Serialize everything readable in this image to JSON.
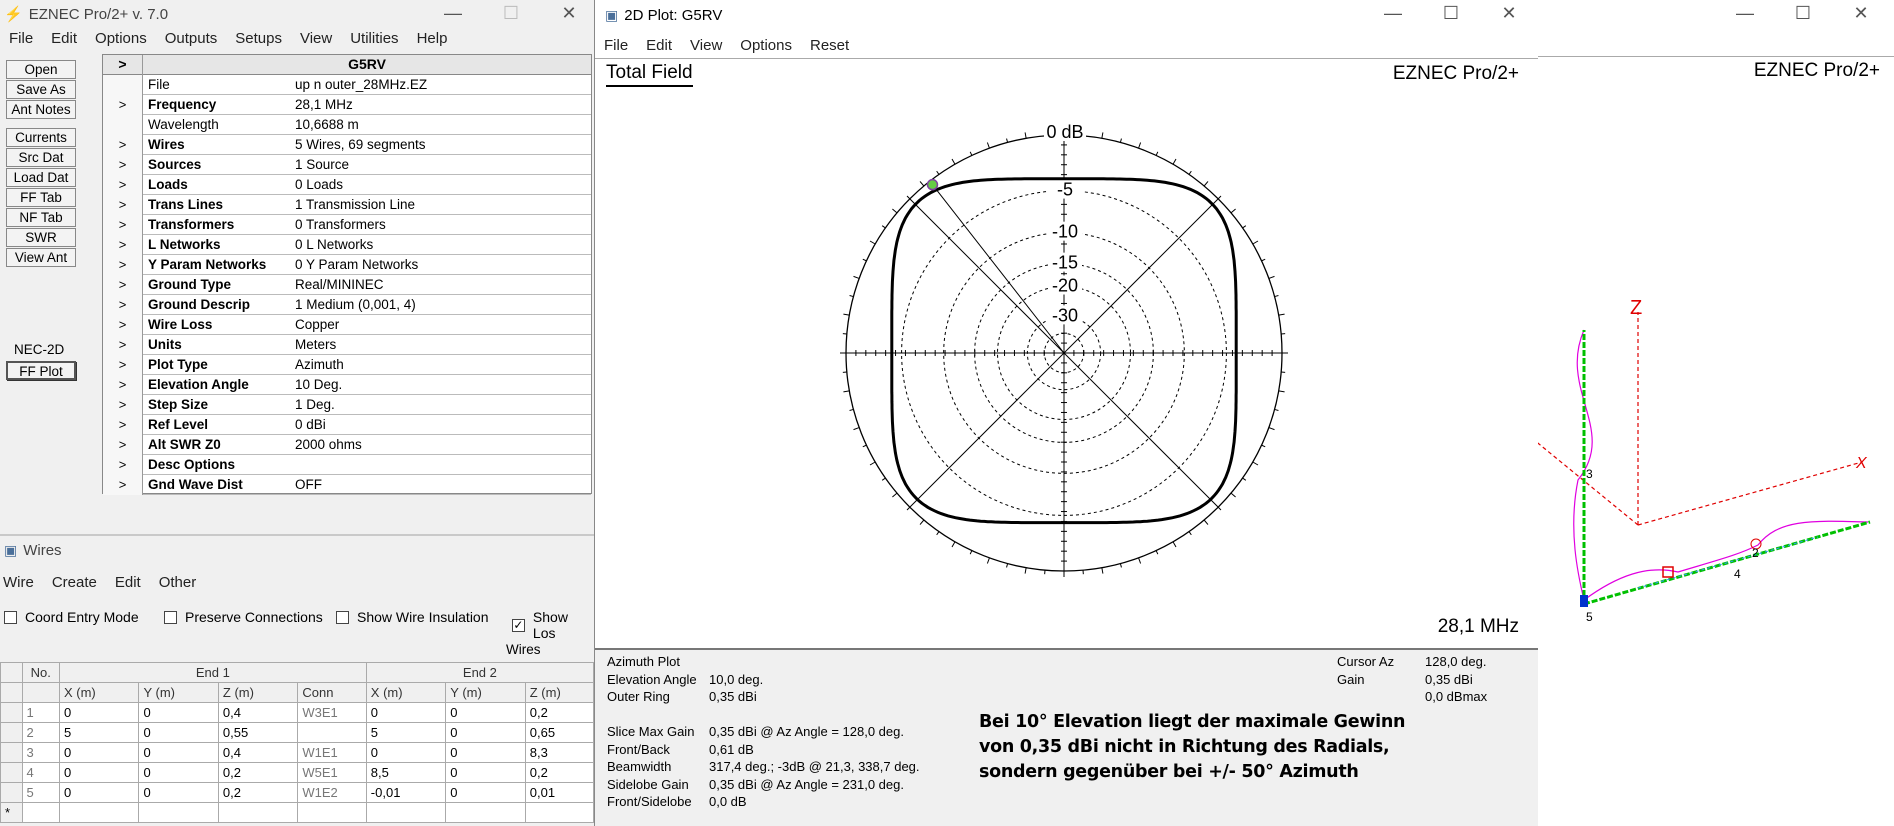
{
  "main": {
    "title": "EZNEC Pro/2+  v. 7.0",
    "menu": [
      "File",
      "Edit",
      "Options",
      "Outputs",
      "Setups",
      "View",
      "Utilities",
      "Help"
    ],
    "buttons": [
      "Open",
      "Save As",
      "Ant Notes",
      "Currents",
      "Src Dat",
      "Load Dat",
      "FF Tab",
      "NF Tab",
      "SWR",
      "View Ant"
    ],
    "nec_label": "NEC-2D",
    "ffplot_button": "FF Plot",
    "grid_header": "G5RV",
    "grid_header_arrow": ">",
    "rows": [
      {
        "k": "File",
        "v": "up n outer_28MHz.EZ",
        "arrow": false,
        "bold": false
      },
      {
        "k": "Frequency",
        "v": "28,1 MHz",
        "arrow": true,
        "bold": true
      },
      {
        "k": "Wavelength",
        "v": "10,6688 m",
        "arrow": false,
        "bold": false
      },
      {
        "k": "Wires",
        "v": "5 Wires, 69 segments",
        "arrow": true,
        "bold": true
      },
      {
        "k": "Sources",
        "v": "1 Source",
        "arrow": true,
        "bold": true
      },
      {
        "k": "Loads",
        "v": "0 Loads",
        "arrow": true,
        "bold": true
      },
      {
        "k": "Trans Lines",
        "v": "1 Transmission Line",
        "arrow": true,
        "bold": true
      },
      {
        "k": "Transformers",
        "v": "0 Transformers",
        "arrow": true,
        "bold": true
      },
      {
        "k": "L Networks",
        "v": "0 L Networks",
        "arrow": true,
        "bold": true
      },
      {
        "k": "Y Param Networks",
        "v": "0 Y Param Networks",
        "arrow": true,
        "bold": true
      },
      {
        "k": "Ground Type",
        "v": "Real/MININEC",
        "arrow": true,
        "bold": true
      },
      {
        "k": "Ground Descrip",
        "v": "1 Medium (0,001, 4)",
        "arrow": true,
        "bold": true
      },
      {
        "k": "Wire Loss",
        "v": "Copper",
        "arrow": true,
        "bold": true
      },
      {
        "k": "Units",
        "v": "Meters",
        "arrow": true,
        "bold": true
      },
      {
        "k": "Plot Type",
        "v": "Azimuth",
        "arrow": true,
        "bold": true
      },
      {
        "k": "Elevation Angle",
        "v": "10 Deg.",
        "arrow": true,
        "bold": true
      },
      {
        "k": "Step Size",
        "v": "1 Deg.",
        "arrow": true,
        "bold": true
      },
      {
        "k": "Ref Level",
        "v": "0 dBi",
        "arrow": true,
        "bold": true
      },
      {
        "k": "Alt SWR Z0",
        "v": "2000 ohms",
        "arrow": true,
        "bold": true
      },
      {
        "k": "Desc Options",
        "v": "",
        "arrow": true,
        "bold": true
      },
      {
        "k": "Gnd Wave Dist",
        "v": "OFF",
        "arrow": true,
        "bold": true
      }
    ],
    "arrow_glyph": ">"
  },
  "wires": {
    "title": "Wires",
    "menu": [
      "Wire",
      "Create",
      "Edit",
      "Other"
    ],
    "checks": [
      {
        "label": "Coord Entry Mode",
        "checked": false
      },
      {
        "label": "Preserve Connections",
        "checked": false
      },
      {
        "label": "Show Wire Insulation",
        "checked": false
      },
      {
        "label": "Show Los",
        "checked": true
      }
    ],
    "table_title": "Wires",
    "col_no": "No.",
    "end1": "End 1",
    "end2": "End 2",
    "cols": [
      "X (m)",
      "Y (m)",
      "Z (m)",
      "Conn",
      "X (m)",
      "Y (m)",
      "Z (m)"
    ],
    "rows": [
      [
        "1",
        "0",
        "0",
        "0,4",
        "W3E1",
        "0",
        "0",
        "0,2"
      ],
      [
        "2",
        "5",
        "0",
        "0,55",
        "",
        "5",
        "0",
        "0,65"
      ],
      [
        "3",
        "0",
        "0",
        "0,4",
        "W1E1",
        "0",
        "0",
        "8,3"
      ],
      [
        "4",
        "0",
        "0",
        "0,2",
        "W5E1",
        "8,5",
        "0",
        "0,2"
      ],
      [
        "5",
        "0",
        "0",
        "0,2",
        "W1E2",
        "-0,01",
        "0",
        "0,01"
      ]
    ],
    "new_row_marker": "*"
  },
  "plot": {
    "title": "2D Plot: G5RV",
    "menu": [
      "File",
      "Edit",
      "View",
      "Options",
      "Reset"
    ],
    "field_label": "Total Field",
    "brand": "EZNEC Pro/2+",
    "freq": "28,1 MHz",
    "ring_labels": [
      "0 dB",
      "-5",
      "-10",
      "-15",
      "-20",
      "-30"
    ],
    "info_left": [
      [
        "Azimuth Plot",
        ""
      ],
      [
        "Elevation Angle",
        "10,0 deg."
      ],
      [
        "Outer Ring",
        "0,35 dBi"
      ],
      [
        "",
        ""
      ],
      [
        "Slice Max Gain",
        "0,35 dBi @ Az Angle = 128,0 deg."
      ],
      [
        "Front/Back",
        "0,61 dB"
      ],
      [
        "Beamwidth",
        "317,4 deg.; -3dB @ 21,3, 338,7 deg."
      ],
      [
        "Sidelobe Gain",
        "0,35 dBi @ Az Angle = 231,0 deg."
      ],
      [
        "Front/Sidelobe",
        "0,0 dB"
      ]
    ],
    "info_right": [
      [
        "Cursor Az",
        "128,0 deg."
      ],
      [
        "Gain",
        "0,35 dBi"
      ],
      [
        "",
        "0,0 dBmax"
      ]
    ],
    "note": [
      "Bei 10° Elevation liegt der maximale Gewinn",
      "von 0,35 dBi nicht in Richtung des Radials,",
      "sondern gegenüber bei +/- 50° Azimuth"
    ]
  },
  "view3d": {
    "brand": "EZNEC Pro/2+",
    "axis_z": "Z",
    "axis_x": "X",
    "wire_labels": [
      "3",
      "2",
      "4",
      "5"
    ]
  },
  "colors": {
    "pattern": "#000000",
    "wire": "#00c000",
    "current": "#e000e0",
    "axis": "#e00000",
    "cursor": "#66cc44"
  },
  "chart_data": {
    "type": "polar",
    "title": "Total Field",
    "plot_type": "Azimuth",
    "elevation_deg": 10.0,
    "outer_ring_dbi": 0.35,
    "ring_labels_db": [
      0,
      -5,
      -10,
      -15,
      -20,
      -30
    ],
    "pattern_shape": "near-omni, slightly squared",
    "max_gain_dbi": 0.35,
    "max_az_deg": 128.0,
    "cursor_az_deg": 128.0,
    "sidelobe_az_deg": 231.0,
    "front_back_db": 0.61,
    "beamwidth_deg": 317.4,
    "minus3db_az_deg": [
      21.3,
      338.7
    ]
  }
}
